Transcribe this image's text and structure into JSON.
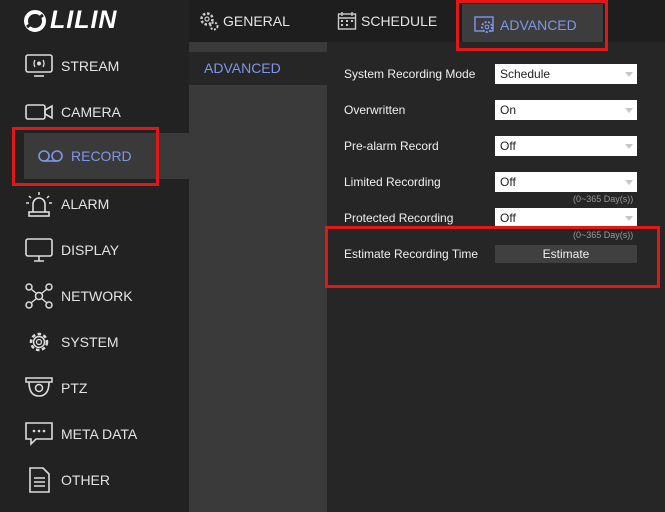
{
  "brand": {
    "logo_text": "LILIN"
  },
  "tabs": [
    {
      "label": "GENERAL",
      "icon": "gear-icon"
    },
    {
      "label": "SCHEDULE",
      "icon": "calendar-icon"
    },
    {
      "label": "ADVANCED",
      "icon": "advanced-icon",
      "active": true
    }
  ],
  "sidebar": {
    "items": [
      {
        "label": "STREAM",
        "icon": "stream-icon"
      },
      {
        "label": "CAMERA",
        "icon": "camera-icon"
      },
      {
        "label": "RECORD",
        "icon": "record-icon",
        "active": true
      },
      {
        "label": "ALARM",
        "icon": "alarm-icon"
      },
      {
        "label": "DISPLAY",
        "icon": "display-icon"
      },
      {
        "label": "NETWORK",
        "icon": "network-icon"
      },
      {
        "label": "SYSTEM",
        "icon": "system-icon"
      },
      {
        "label": "PTZ",
        "icon": "ptz-icon"
      },
      {
        "label": "META DATA",
        "icon": "metadata-icon"
      },
      {
        "label": "OTHER",
        "icon": "other-icon"
      }
    ]
  },
  "subnav": {
    "items": [
      {
        "label": "ADVANCED"
      }
    ]
  },
  "form": {
    "system_recording_mode": {
      "label": "System Recording Mode",
      "value": "Schedule"
    },
    "overwritten": {
      "label": "Overwritten",
      "value": "On"
    },
    "pre_alarm_record": {
      "label": "Pre-alarm Record",
      "value": "Off"
    },
    "limited_recording": {
      "label": "Limited Recording",
      "value": "Off",
      "hint": "(0~365 Day(s))"
    },
    "protected_recording": {
      "label": "Protected Recording",
      "value": "Off",
      "hint": "(0~365 Day(s))"
    },
    "estimate_recording_time": {
      "label": "Estimate Recording Time",
      "button": "Estimate"
    }
  },
  "colors": {
    "accent": "#7f96e8",
    "highlight": "#e01818"
  }
}
